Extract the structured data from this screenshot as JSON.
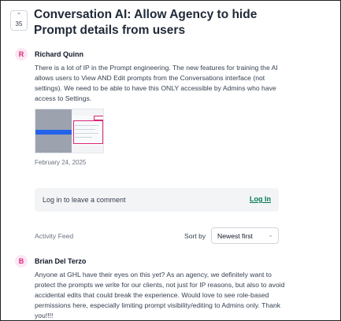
{
  "post": {
    "vote_count": "35",
    "title": "Conversation AI: Allow Agency to hide Prompt details from users"
  },
  "original_post": {
    "avatar_letter": "R",
    "author": "Richard Quinn",
    "body": "There is a lot of IP in the Prompt engineering. The new features for training the AI allows users to View AND Edit prompts from the Conversations interface (not settings). We need to be able to have this ONLY accessible by Admins who have access to Settings.",
    "date": "February 24, 2025"
  },
  "login": {
    "prompt": "Log in to leave a comment",
    "link": "Log In"
  },
  "feed": {
    "label": "Activity Feed",
    "sort_label": "Sort by",
    "sort_value": "Newest first"
  },
  "comments": [
    {
      "avatar_letter": "B",
      "author": "Brian Del Terzo",
      "body": "Anyone at GHL have their eyes on this yet? As an agency, we definitely want to protect the prompts we write for our clients, not just for IP reasons, but also to avoid accidental edits that could break the experience. Would love to see role-based permissions here, especially limiting prompt visibility/editing to Admins only. Thank you!!!!"
    }
  ],
  "colors": {
    "avatar_bg": "#fce7f3",
    "avatar_fg": "#db2777",
    "link": "#047857"
  }
}
